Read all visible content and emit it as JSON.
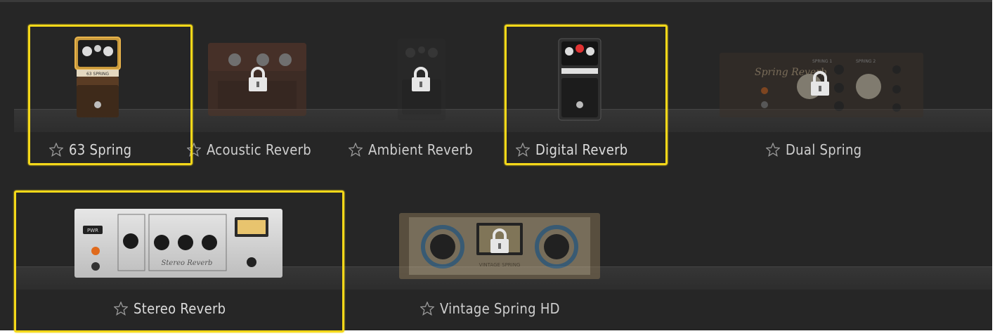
{
  "presets": [
    {
      "name": "63 Spring",
      "locked": false,
      "highlighted": true
    },
    {
      "name": "Acoustic Reverb",
      "locked": true,
      "highlighted": false
    },
    {
      "name": "Ambient Reverb",
      "locked": true,
      "highlighted": false
    },
    {
      "name": "Digital Reverb",
      "locked": false,
      "highlighted": true
    },
    {
      "name": "Dual Spring",
      "locked": true,
      "highlighted": false
    },
    {
      "name": "Stereo Reverb",
      "locked": false,
      "highlighted": true
    },
    {
      "name": "Vintage Spring HD",
      "locked": true,
      "highlighted": false
    }
  ],
  "device_text": {
    "spring_pedal_label": "63 SPRING",
    "dual_spring_script": "Spring Reverb",
    "dual_spring_labels": [
      "SPRING 1",
      "SPRING 2"
    ],
    "stereo_power_label": "PWR",
    "stereo_script": "Stereo Reverb",
    "vintage_script": "VINTAGE SPRING"
  },
  "colors": {
    "background": "#262626",
    "highlight": "#f4d819",
    "label": "#dcdcdc"
  }
}
